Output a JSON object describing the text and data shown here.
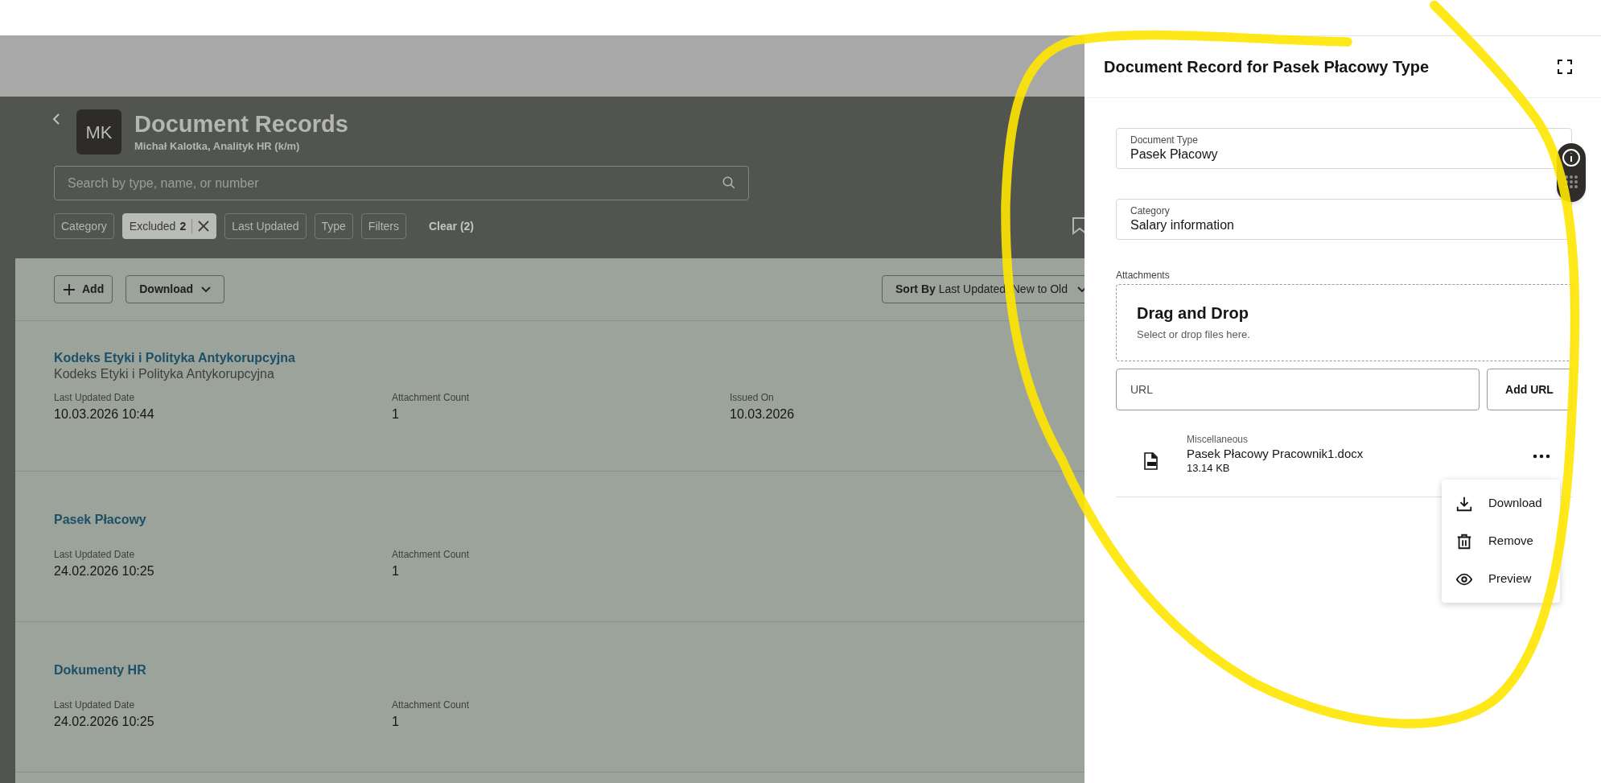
{
  "page": {
    "avatar_initials": "MK",
    "title": "Document Records",
    "subtitle": "Michał Kalotka, Analityk HR (k/m)"
  },
  "search": {
    "placeholder": "Search by type, name, or number"
  },
  "filters": [
    {
      "label": "Category",
      "selected": false
    },
    {
      "label": "Excluded",
      "count": "2",
      "selected": true
    },
    {
      "label": "Last Updated",
      "selected": false
    },
    {
      "label": "Type",
      "selected": false
    },
    {
      "label": "Filters",
      "selected": false
    }
  ],
  "clear": "Clear (2)",
  "toolbar": {
    "add": "Add",
    "download": "Download",
    "sort_label": "Sort By",
    "sort_value": "Last Updated, New to Old"
  },
  "records": [
    {
      "title": "Kodeks Etyki i Polityka Antykorupcyjna",
      "subtitle": "Kodeks Etyki i Polityka Antykorupcyjna",
      "fields": [
        {
          "label": "Last Updated Date",
          "value": "10.03.2026 10:44"
        },
        {
          "label": "Attachment Count",
          "value": "1"
        },
        {
          "label": "Issued On",
          "value": "10.03.2026"
        }
      ]
    },
    {
      "title": "Pasek Płacowy",
      "fields": [
        {
          "label": "Last Updated Date",
          "value": "24.02.2026 10:25"
        },
        {
          "label": "Attachment Count",
          "value": "1"
        }
      ]
    },
    {
      "title": "Dokumenty HR",
      "fields": [
        {
          "label": "Last Updated Date",
          "value": "24.02.2026 10:25"
        },
        {
          "label": "Attachment Count",
          "value": "1"
        }
      ]
    }
  ],
  "panel": {
    "title": "Document Record for Pasek Płacowy Type",
    "fields": [
      {
        "label": "Document Type",
        "value": "Pasek Płacowy"
      },
      {
        "label": "Category",
        "value": "Salary information"
      }
    ],
    "attachments_label": "Attachments",
    "drop_title": "Drag and Drop",
    "drop_hint": "Select or drop files here.",
    "url": {
      "placeholder": "URL"
    },
    "add_url": "Add URL",
    "file": {
      "category": "Miscellaneous",
      "name": "Pasek Płacowy Pracownik1.docx",
      "size": "13.14 KB"
    },
    "menu": [
      {
        "kind": "download",
        "label": "Download"
      },
      {
        "kind": "remove",
        "label": "Remove"
      },
      {
        "kind": "preview",
        "label": "Preview"
      }
    ]
  }
}
